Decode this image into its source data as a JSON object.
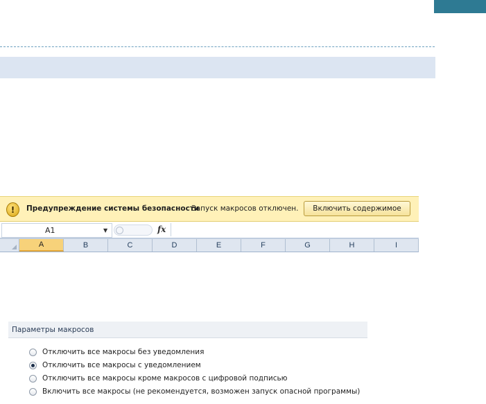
{
  "security_bar": {
    "icon": "warning-shield-icon",
    "title": "Предупреждение системы безопасности",
    "message": "Запуск макросов отключен.",
    "enable_button": "Включить содержимое"
  },
  "formula_bar": {
    "name_box": "A1",
    "fx": "fx",
    "value": ""
  },
  "columns": [
    "A",
    "B",
    "C",
    "D",
    "E",
    "F",
    "G",
    "H",
    "I"
  ],
  "active_column": "A",
  "macro_settings": {
    "title": "Параметры макросов",
    "options": [
      {
        "label": "Отключить все макросы без уведомления",
        "checked": false
      },
      {
        "label": "Отключить все макросы с уведомлением",
        "checked": true
      },
      {
        "label": "Отключить все макросы кроме макросов с цифровой подписью",
        "checked": false
      },
      {
        "label": "Включить все макросы (не рекомендуется, возможен запуск опасной программы)",
        "checked": false
      }
    ]
  },
  "colors": {
    "corner_block": "#2e7a93",
    "band": "#dce5f2",
    "security_bar_bg": "#fff1b8"
  }
}
